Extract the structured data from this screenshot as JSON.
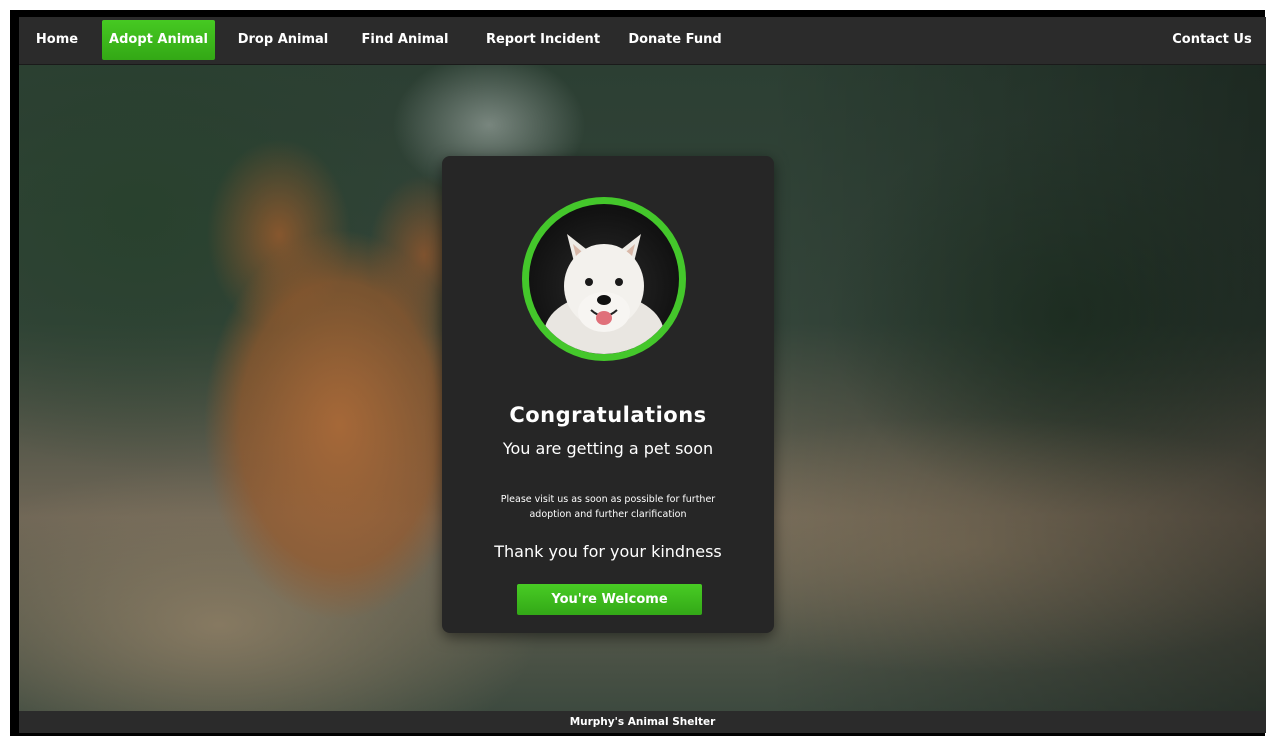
{
  "nav": {
    "items": [
      {
        "label": "Home",
        "active": false
      },
      {
        "label": "Adopt Animal",
        "active": true
      },
      {
        "label": "Drop Animal",
        "active": false
      },
      {
        "label": "Find Animal",
        "active": false
      },
      {
        "label": "Report Incident",
        "active": false
      },
      {
        "label": "Donate Fund",
        "active": false
      }
    ],
    "contact_label": "Contact Us"
  },
  "card": {
    "title": "Congratulations",
    "subtitle": "You are getting a pet soon",
    "note": "Please visit us as soon as possible for further adoption and further clarification",
    "thanks": "Thank you for your kindness",
    "button_label": "You're Welcome"
  },
  "footer": {
    "text": "Murphy's Animal Shelter"
  },
  "colors": {
    "accent": "#3cba1c",
    "nav_bg": "#2b2b2b",
    "card_bg": "#262626",
    "avatar_ring": "#44c72b"
  }
}
